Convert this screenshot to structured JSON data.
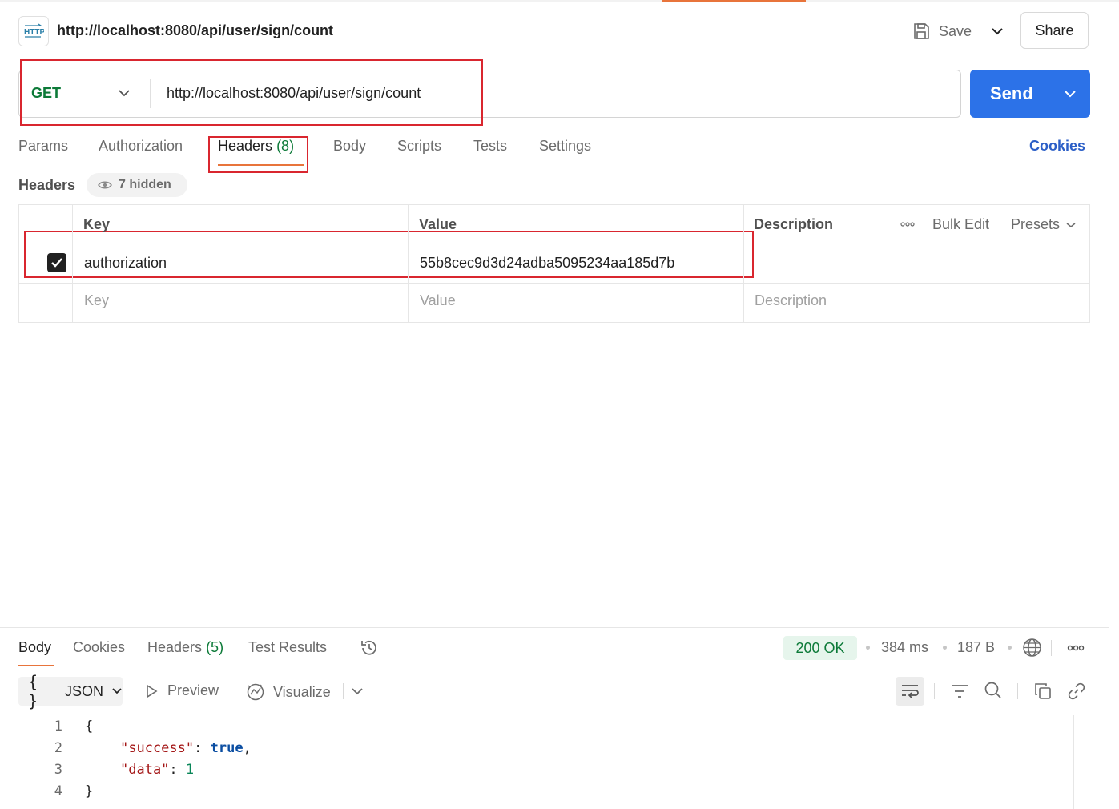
{
  "header": {
    "title": "http://localhost:8080/api/user/sign/count",
    "save_label": "Save",
    "share_label": "Share"
  },
  "request": {
    "method": "GET",
    "url": "http://localhost:8080/api/user/sign/count",
    "send_label": "Send"
  },
  "tabs": [
    {
      "label": "Params"
    },
    {
      "label": "Authorization"
    },
    {
      "label": "Headers",
      "count": "(8)"
    },
    {
      "label": "Body"
    },
    {
      "label": "Scripts"
    },
    {
      "label": "Tests"
    },
    {
      "label": "Settings"
    }
  ],
  "cookies_label": "Cookies",
  "headers_section": {
    "label": "Headers",
    "hidden_label": "7 hidden",
    "columns": {
      "key": "Key",
      "value": "Value",
      "description": "Description"
    },
    "bulk_edit": "Bulk Edit",
    "presets": "Presets",
    "rows": [
      {
        "key": "authorization",
        "value": "55b8cec9d3d24adba5095234aa185d7b",
        "checked": true
      }
    ],
    "placeholders": {
      "key": "Key",
      "value": "Value",
      "description": "Description"
    }
  },
  "response": {
    "tabs": [
      {
        "label": "Body"
      },
      {
        "label": "Cookies"
      },
      {
        "label": "Headers",
        "count": "(5)"
      },
      {
        "label": "Test Results"
      }
    ],
    "status": "200 OK",
    "time": "384 ms",
    "size": "187 B",
    "format": "JSON",
    "preview_label": "Preview",
    "visualize_label": "Visualize",
    "code_lines": [
      {
        "num": "1",
        "open": "{"
      },
      {
        "num": "2",
        "key": "\"success\"",
        "sep": ": ",
        "value": "true",
        "end": ","
      },
      {
        "num": "3",
        "key": "\"data\"",
        "sep": ": ",
        "value": "1"
      },
      {
        "num": "4",
        "close": "}"
      }
    ]
  },
  "colors": {
    "accent": "#e8743b",
    "send": "#2c72e8",
    "method_get": "#0c7a38",
    "annotation_red": "#d9262f"
  }
}
